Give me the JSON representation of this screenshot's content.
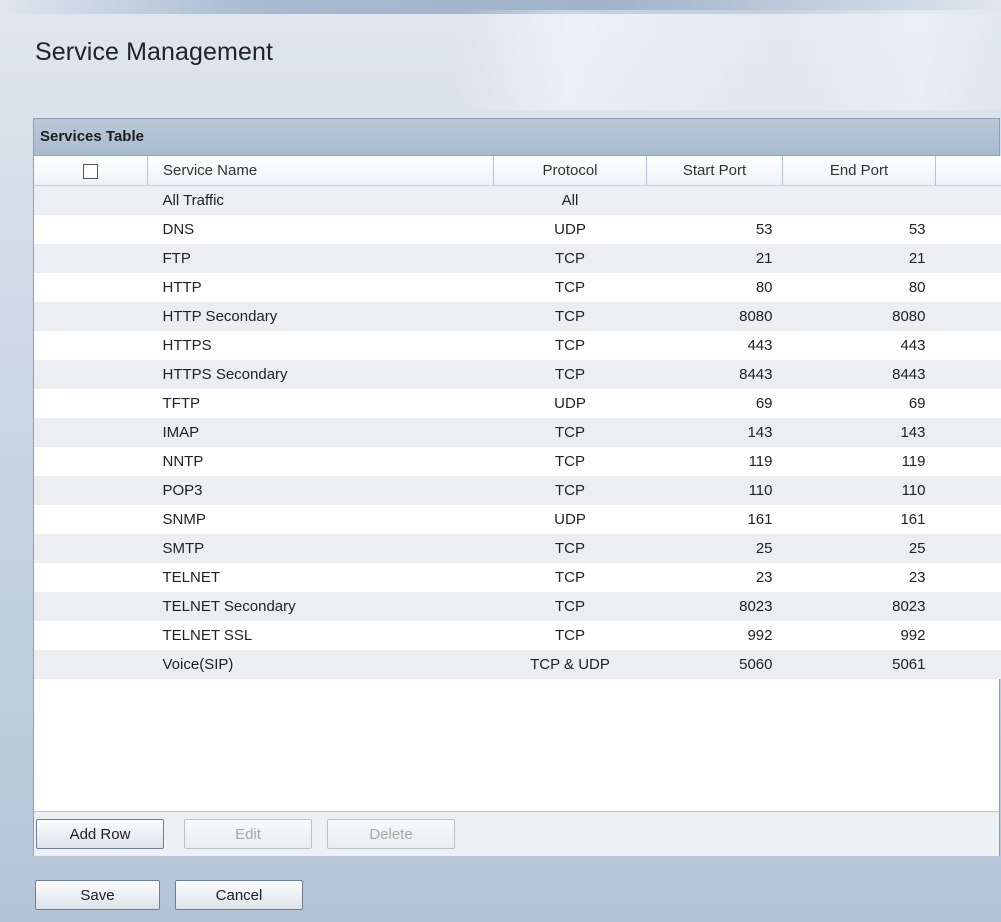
{
  "page": {
    "title": "Service Management"
  },
  "services_table": {
    "caption": "Services Table",
    "columns": {
      "name": "Service Name",
      "protocol": "Protocol",
      "start_port": "Start Port",
      "end_port": "End Port"
    },
    "rows": [
      {
        "name": "All Traffic",
        "protocol": "All",
        "start_port": "",
        "end_port": ""
      },
      {
        "name": "DNS",
        "protocol": "UDP",
        "start_port": "53",
        "end_port": "53"
      },
      {
        "name": "FTP",
        "protocol": "TCP",
        "start_port": "21",
        "end_port": "21"
      },
      {
        "name": "HTTP",
        "protocol": "TCP",
        "start_port": "80",
        "end_port": "80"
      },
      {
        "name": "HTTP Secondary",
        "protocol": "TCP",
        "start_port": "8080",
        "end_port": "8080"
      },
      {
        "name": "HTTPS",
        "protocol": "TCP",
        "start_port": "443",
        "end_port": "443"
      },
      {
        "name": "HTTPS Secondary",
        "protocol": "TCP",
        "start_port": "8443",
        "end_port": "8443"
      },
      {
        "name": "TFTP",
        "protocol": "UDP",
        "start_port": "69",
        "end_port": "69"
      },
      {
        "name": "IMAP",
        "protocol": "TCP",
        "start_port": "143",
        "end_port": "143"
      },
      {
        "name": "NNTP",
        "protocol": "TCP",
        "start_port": "119",
        "end_port": "119"
      },
      {
        "name": "POP3",
        "protocol": "TCP",
        "start_port": "110",
        "end_port": "110"
      },
      {
        "name": "SNMP",
        "protocol": "UDP",
        "start_port": "161",
        "end_port": "161"
      },
      {
        "name": "SMTP",
        "protocol": "TCP",
        "start_port": "25",
        "end_port": "25"
      },
      {
        "name": "TELNET",
        "protocol": "TCP",
        "start_port": "23",
        "end_port": "23"
      },
      {
        "name": "TELNET Secondary",
        "protocol": "TCP",
        "start_port": "8023",
        "end_port": "8023"
      },
      {
        "name": "TELNET SSL",
        "protocol": "TCP",
        "start_port": "992",
        "end_port": "992"
      },
      {
        "name": "Voice(SIP)",
        "protocol": "TCP & UDP",
        "start_port": "5060",
        "end_port": "5061"
      }
    ],
    "actions": {
      "add_row": "Add Row",
      "edit": "Edit",
      "delete": "Delete"
    }
  },
  "footer": {
    "save": "Save",
    "cancel": "Cancel"
  }
}
